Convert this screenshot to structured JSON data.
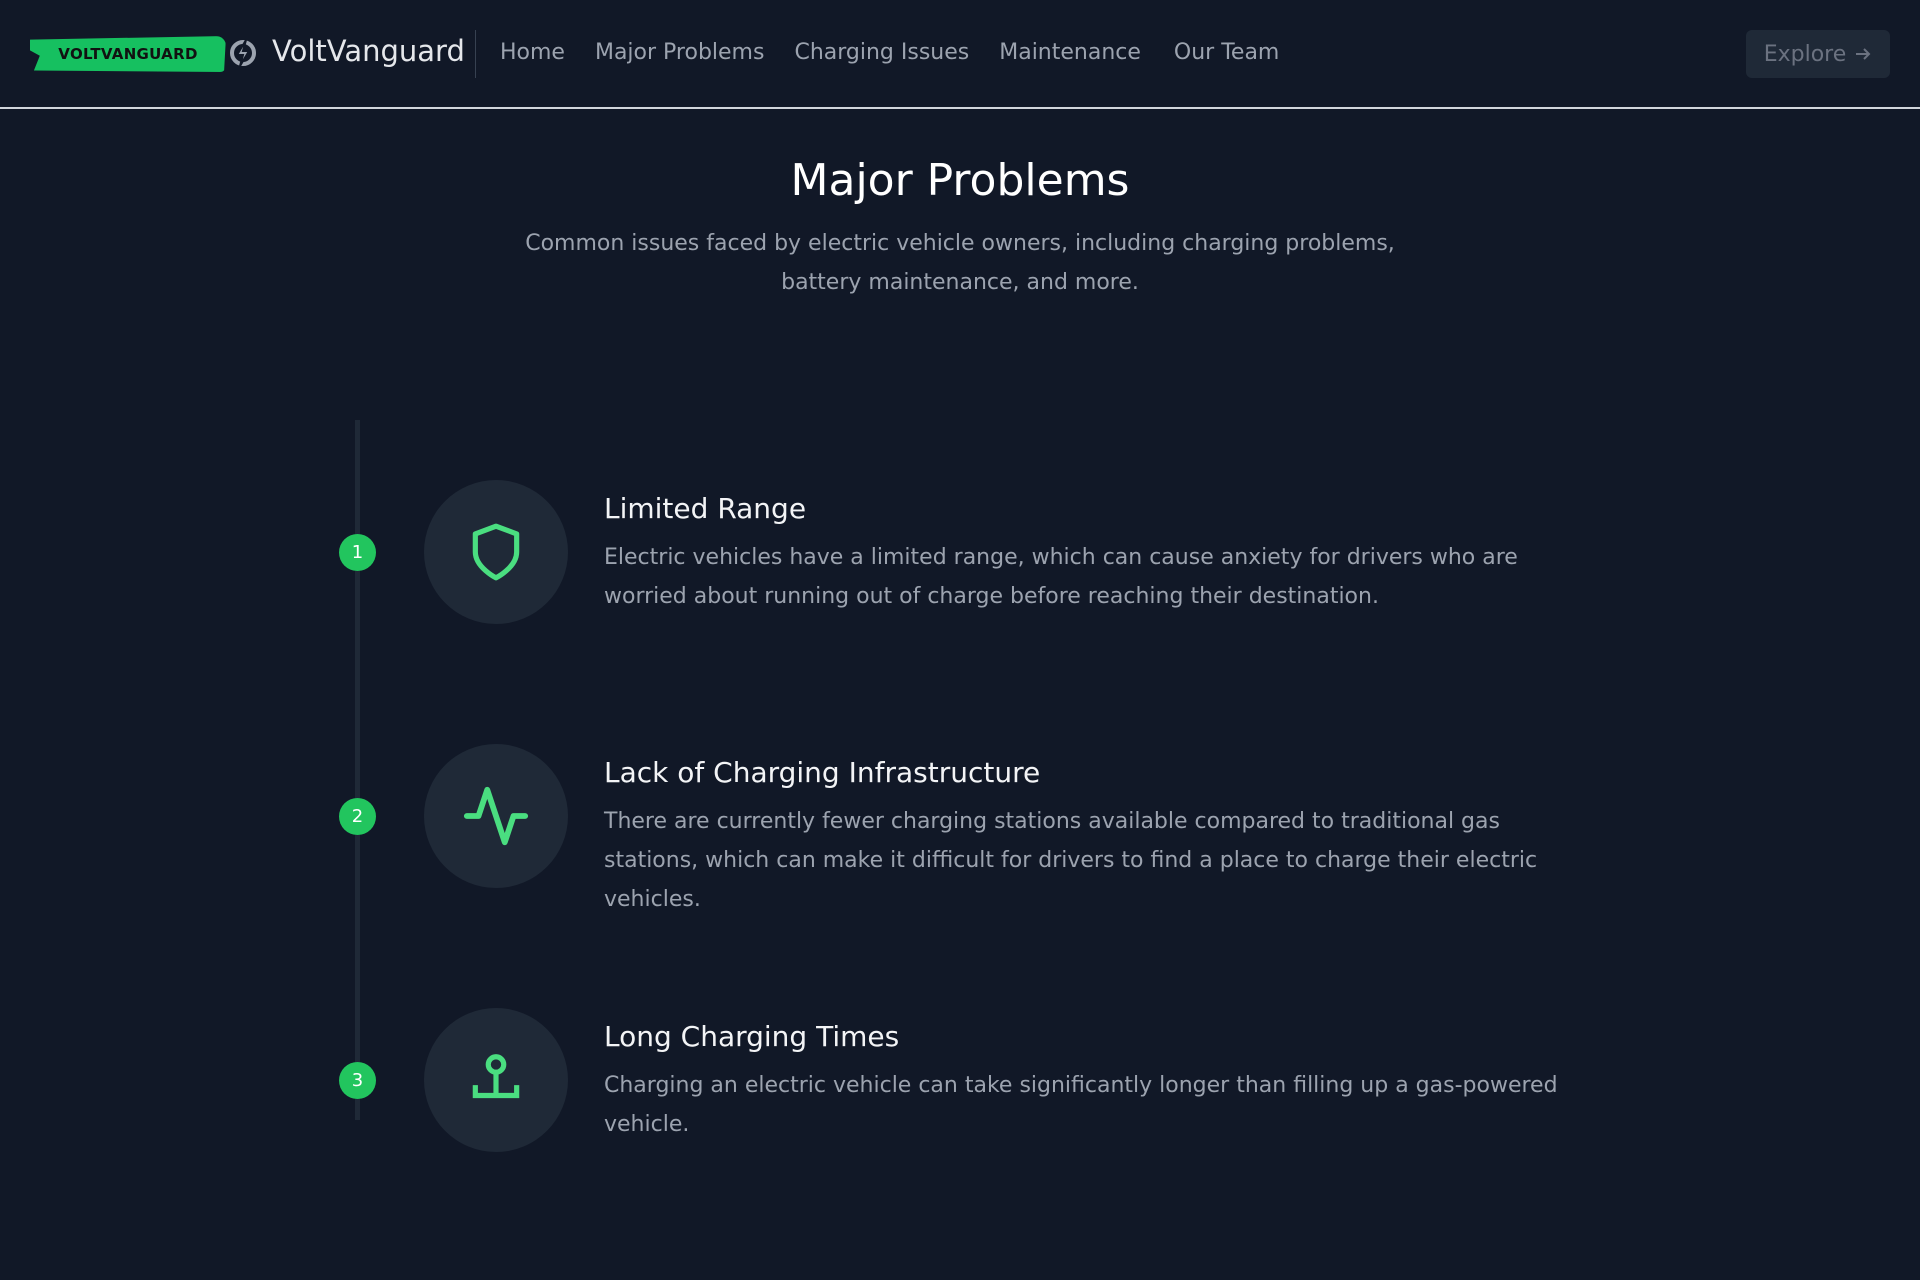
{
  "nav": {
    "logo_text": "VOLTVANGUARD",
    "brand": "VoltVanguard",
    "links": [
      "Home",
      "Major Problems",
      "Charging Issues",
      "Maintenance",
      "Our Team"
    ],
    "explore": "Explore",
    "explore_icon": "arrow-right-icon"
  },
  "hero": {
    "title": "Major Problems",
    "subtitle": "Common issues faced by electric vehicle owners, including charging problems, battery maintenance, and more."
  },
  "colors": {
    "accent": "#22c55e",
    "background": "#111827",
    "card": "#1f2937"
  },
  "items": [
    {
      "number": "1",
      "icon": "shield-icon",
      "title": "Limited Range",
      "description": "Electric vehicles have a limited range, which can cause anxiety for drivers who are worried about running out of charge before reaching their destination."
    },
    {
      "number": "2",
      "icon": "activity-icon",
      "title": "Lack of Charging Infrastructure",
      "description": "There are currently fewer charging stations available compared to traditional gas stations, which can make it difficult for drivers to find a place to charge their electric vehicles."
    },
    {
      "number": "3",
      "icon": "network-icon",
      "title": "Long Charging Times",
      "description": "Charging an electric vehicle can take significantly longer than filling up a gas-powered vehicle."
    }
  ]
}
